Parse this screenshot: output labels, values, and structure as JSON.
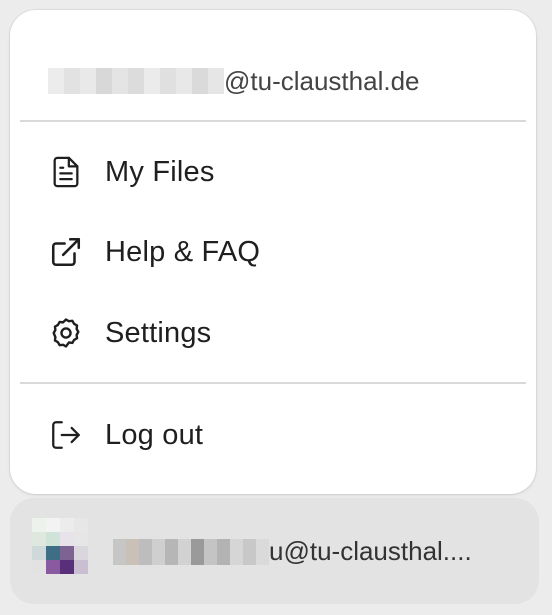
{
  "menu": {
    "email_suffix": "@tu-clausthal.de",
    "items": [
      {
        "label": "My Files",
        "icon": "file-text-icon"
      },
      {
        "label": "Help & FAQ",
        "icon": "external-link-icon"
      },
      {
        "label": "Settings",
        "icon": "gear-icon"
      }
    ],
    "logout": {
      "label": "Log out",
      "icon": "log-out-icon"
    }
  },
  "account": {
    "email_suffix": "u@tu-clausthal...."
  },
  "colors": {
    "menu_bg": "#ffffff",
    "page_bg": "#ececec",
    "account_bar_bg": "#e3e3e3",
    "divider": "#d9d9d9",
    "text": "#1f1f1f"
  }
}
